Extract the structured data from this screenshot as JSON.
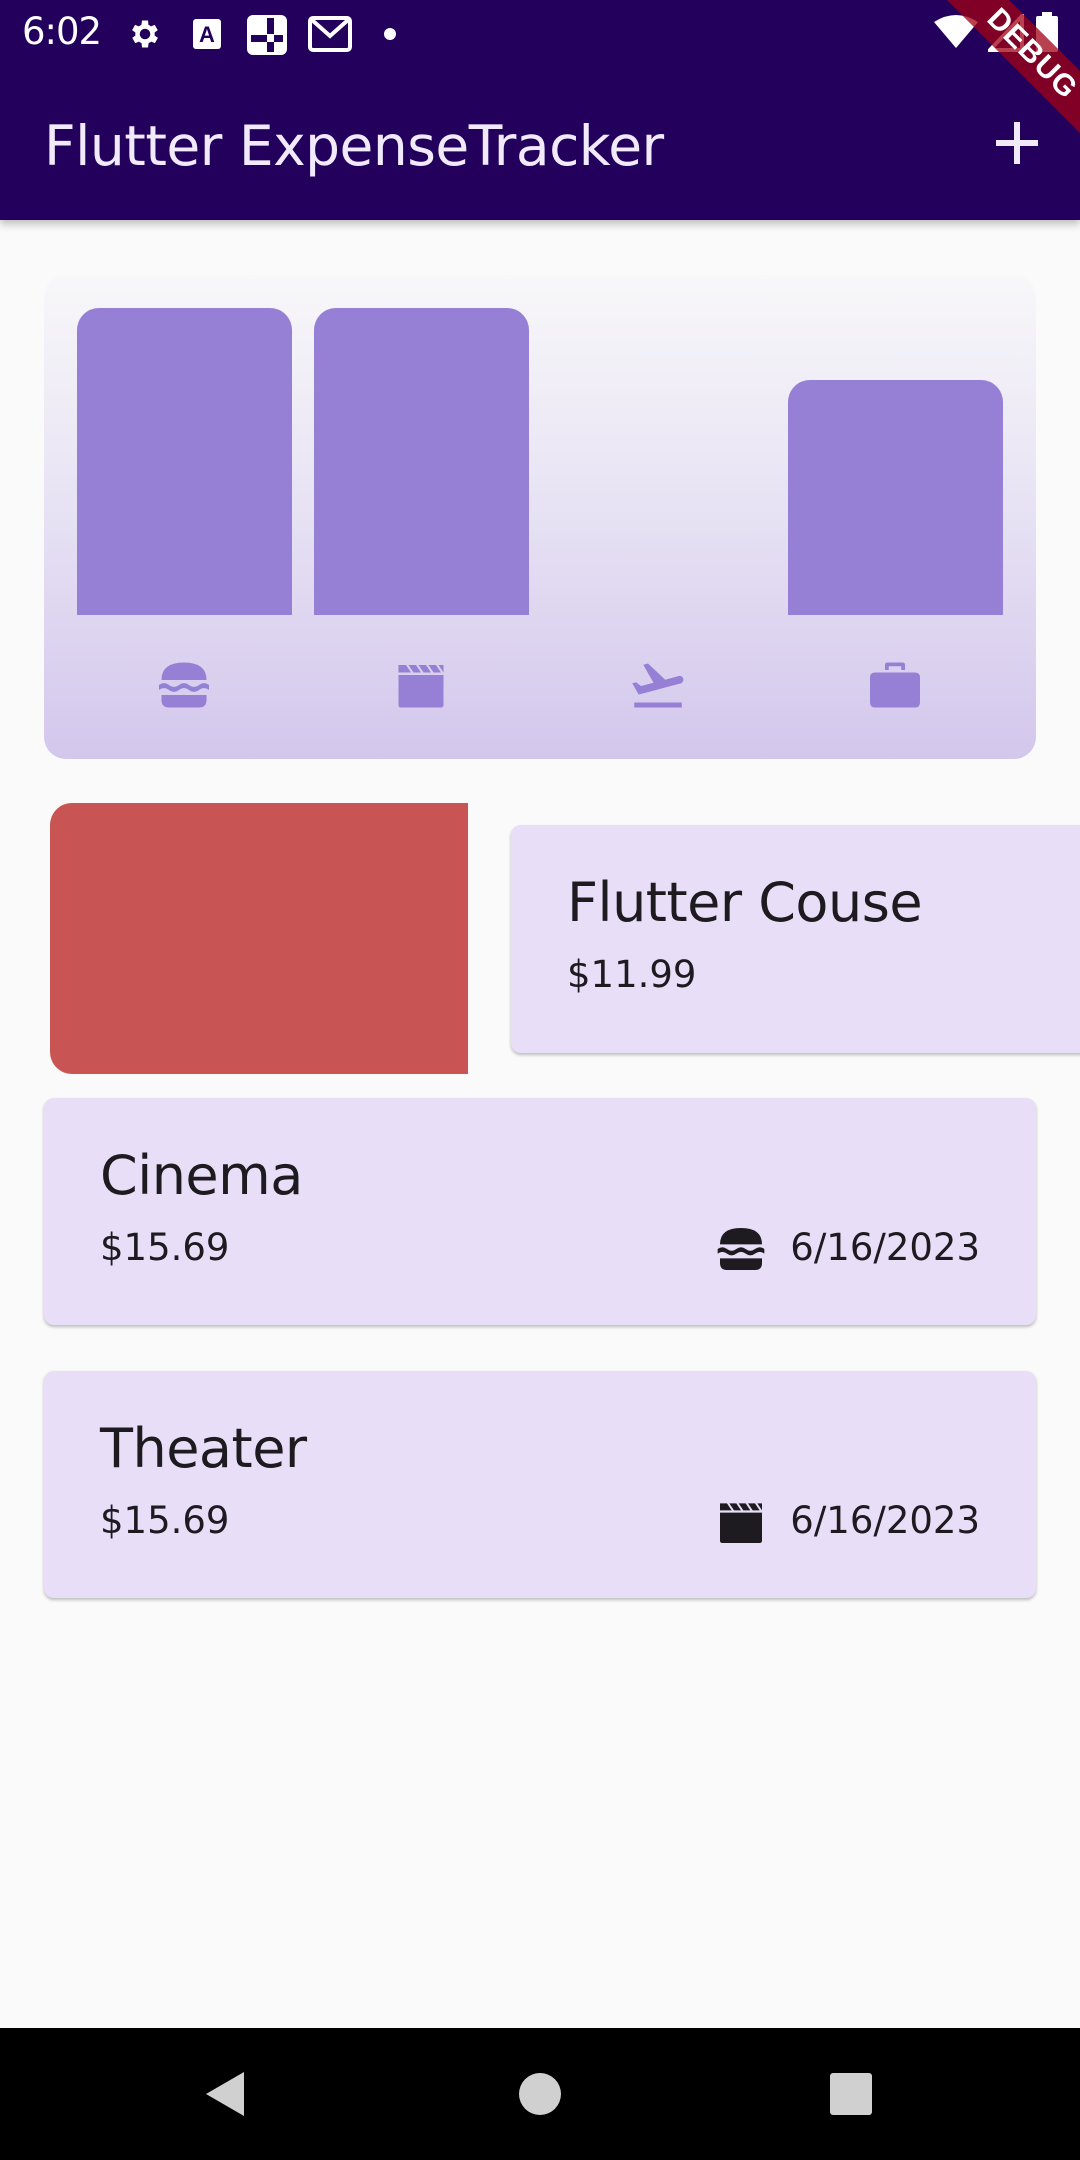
{
  "status_bar": {
    "time": "6:02",
    "icons": [
      "settings-icon",
      "a-notification-icon",
      "crossword-icon",
      "gmail-icon",
      "dot-icon",
      "wifi-icon",
      "signal-icon",
      "battery-icon"
    ]
  },
  "app_bar": {
    "title": "Flutter ExpenseTracker",
    "add_icon": "plus-icon",
    "debug_label": "DEBUG"
  },
  "chart_data": {
    "type": "bar",
    "categories": [
      "food",
      "leisure",
      "travel",
      "work"
    ],
    "category_icons": [
      "hamburger-icon",
      "movie-clapper-icon",
      "flight-takeoff-icon",
      "briefcase-icon"
    ],
    "values": [
      1.0,
      1.0,
      0.0,
      0.765
    ],
    "value_scale": "relative to largest category",
    "bar_color": "#9680d5",
    "title": "",
    "xlabel": "",
    "ylabel": ""
  },
  "expenses": [
    {
      "title": "Flutter Couse",
      "amount": "$11.99",
      "date": "",
      "category_icon": "",
      "state": "swiping-to-dismiss"
    },
    {
      "title": "Cinema",
      "amount": "$15.69",
      "date": "6/16/2023",
      "category_icon": "hamburger-icon"
    },
    {
      "title": "Theater",
      "amount": "$15.69",
      "date": "6/16/2023",
      "category_icon": "movie-clapper-icon"
    }
  ],
  "colors": {
    "app_bar": "#23005c",
    "card": "#e8def8",
    "dismiss_background": "#c85553",
    "chart_bar": "#9680d5"
  },
  "nav_bar": {
    "buttons": [
      "back-icon",
      "home-icon",
      "recents-icon"
    ]
  }
}
